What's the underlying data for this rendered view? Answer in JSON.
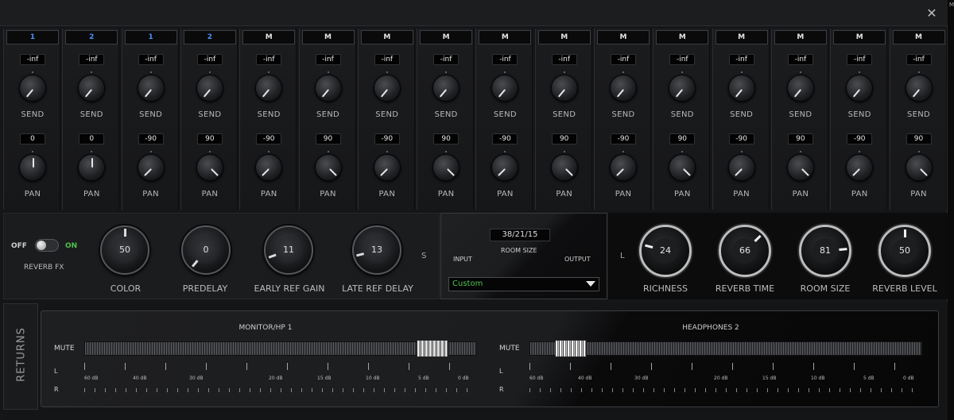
{
  "window": {
    "close_label": "✕"
  },
  "channels": [
    {
      "name": "1",
      "blue": true,
      "send_value": "-inf",
      "send_label": "SEND",
      "pan_value": "0",
      "pan_label": "PAN",
      "send_angle": -140,
      "pan_angle": 0
    },
    {
      "name": "2",
      "blue": true,
      "send_value": "-inf",
      "send_label": "SEND",
      "pan_value": "0",
      "pan_label": "PAN",
      "send_angle": -140,
      "pan_angle": 0
    },
    {
      "name": "1",
      "blue": true,
      "send_value": "-inf",
      "send_label": "SEND",
      "pan_value": "-90",
      "pan_label": "PAN",
      "send_angle": -140,
      "pan_angle": -135
    },
    {
      "name": "2",
      "blue": true,
      "send_value": "-inf",
      "send_label": "SEND",
      "pan_value": "90",
      "pan_label": "PAN",
      "send_angle": -140,
      "pan_angle": 135
    },
    {
      "name": "M",
      "blue": false,
      "send_value": "-inf",
      "send_label": "SEND",
      "pan_value": "-90",
      "pan_label": "PAN",
      "send_angle": -140,
      "pan_angle": -135
    },
    {
      "name": "M",
      "blue": false,
      "send_value": "-inf",
      "send_label": "SEND",
      "pan_value": "90",
      "pan_label": "PAN",
      "send_angle": -140,
      "pan_angle": 135
    },
    {
      "name": "M",
      "blue": false,
      "send_value": "-inf",
      "send_label": "SEND",
      "pan_value": "-90",
      "pan_label": "PAN",
      "send_angle": -140,
      "pan_angle": -135
    },
    {
      "name": "M",
      "blue": false,
      "send_value": "-inf",
      "send_label": "SEND",
      "pan_value": "90",
      "pan_label": "PAN",
      "send_angle": -140,
      "pan_angle": 135
    },
    {
      "name": "M",
      "blue": false,
      "send_value": "-inf",
      "send_label": "SEND",
      "pan_value": "-90",
      "pan_label": "PAN",
      "send_angle": -140,
      "pan_angle": -135
    },
    {
      "name": "M",
      "blue": false,
      "send_value": "-inf",
      "send_label": "SEND",
      "pan_value": "90",
      "pan_label": "PAN",
      "send_angle": -140,
      "pan_angle": 135
    },
    {
      "name": "M",
      "blue": false,
      "send_value": "-inf",
      "send_label": "SEND",
      "pan_value": "-90",
      "pan_label": "PAN",
      "send_angle": -140,
      "pan_angle": -135
    },
    {
      "name": "M",
      "blue": false,
      "send_value": "-inf",
      "send_label": "SEND",
      "pan_value": "90",
      "pan_label": "PAN",
      "send_angle": -140,
      "pan_angle": 135
    },
    {
      "name": "M",
      "blue": false,
      "send_value": "-inf",
      "send_label": "SEND",
      "pan_value": "-90",
      "pan_label": "PAN",
      "send_angle": -140,
      "pan_angle": -135
    },
    {
      "name": "M",
      "blue": false,
      "send_value": "-inf",
      "send_label": "SEND",
      "pan_value": "90",
      "pan_label": "PAN",
      "send_angle": -140,
      "pan_angle": 135
    },
    {
      "name": "M",
      "blue": false,
      "send_value": "-inf",
      "send_label": "SEND",
      "pan_value": "-90",
      "pan_label": "PAN",
      "send_angle": -140,
      "pan_angle": -135
    },
    {
      "name": "M",
      "blue": false,
      "send_value": "-inf",
      "send_label": "SEND",
      "pan_value": "90",
      "pan_label": "PAN",
      "send_angle": -140,
      "pan_angle": 135
    }
  ],
  "reverb": {
    "off_label": "OFF",
    "on_label": "ON",
    "fx_label": "REVERB FX",
    "s_label": "S",
    "l_label": "L",
    "knobs": [
      {
        "label": "COLOR",
        "value": "50",
        "angle": 0
      },
      {
        "label": "PREDELAY",
        "value": "0",
        "angle": -140
      },
      {
        "label": "EARLY REF GAIN",
        "value": "11",
        "angle": -110
      },
      {
        "label": "LATE REF DELAY",
        "value": "13",
        "angle": -105
      }
    ],
    "right_knobs": [
      {
        "label": "RICHNESS",
        "value": "24",
        "angle": -75
      },
      {
        "label": "REVERB TIME",
        "value": "66",
        "angle": 45
      },
      {
        "label": "ROOM SIZE",
        "value": "81",
        "angle": 85
      },
      {
        "label": "REVERB LEVEL",
        "value": "50",
        "angle": 0
      }
    ],
    "room_size_value": "38/21/15",
    "room_size_label": "ROOM SIZE",
    "input_label": "INPUT",
    "output_label": "OUTPUT",
    "preset": "Custom"
  },
  "returns": {
    "tab_label": "RETURNS",
    "mute_label": "MUTE",
    "left_label": "L",
    "right_label": "R",
    "scale": [
      "60 dB",
      "40 dB",
      "30 dB",
      "20 dB",
      "15 dB",
      "10 dB",
      "5 dB",
      "0 dB"
    ],
    "outputs": [
      {
        "title": "MONITOR/HP 1",
        "fader_level": 0.92
      },
      {
        "title": "HEADPHONES 2",
        "fader_level": 0.07
      }
    ]
  }
}
